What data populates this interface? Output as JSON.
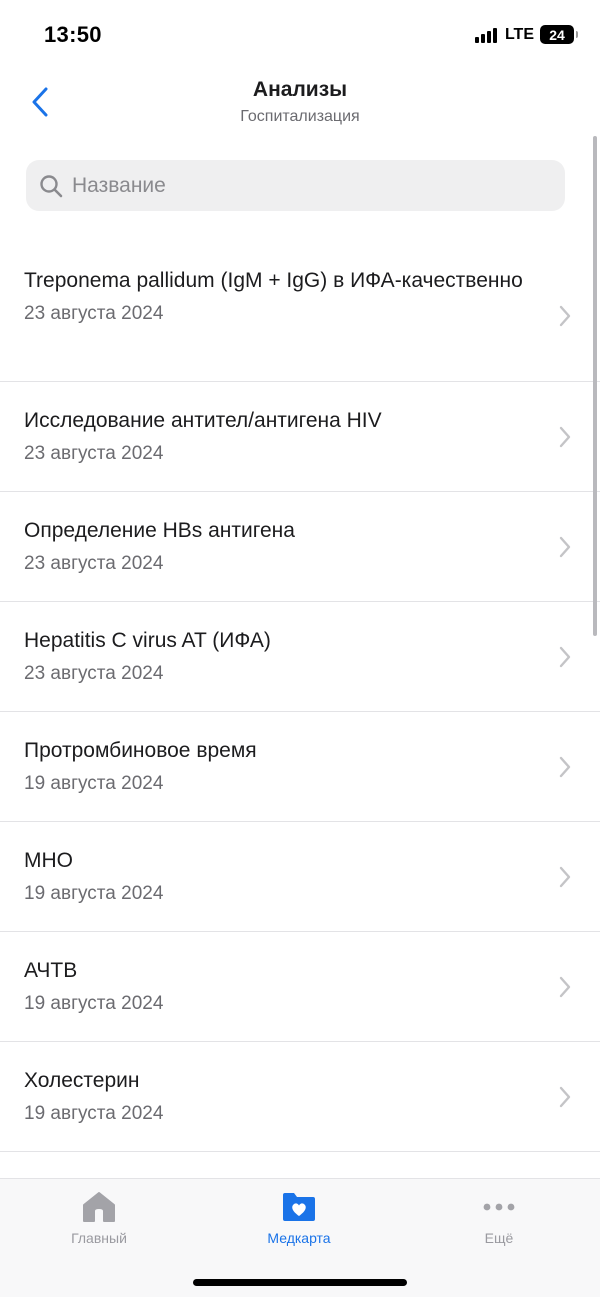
{
  "status_bar": {
    "time": "13:50",
    "network": "LTE",
    "battery": "24"
  },
  "header": {
    "title": "Анализы",
    "subtitle": "Госпитализация",
    "back_icon": "chevron-left-icon"
  },
  "search": {
    "placeholder": "Название",
    "value": ""
  },
  "list": {
    "items": [
      {
        "title": "Treponema pallidum (IgM + IgG) в ИФА-качественно",
        "date": "23 августа 2024"
      },
      {
        "title": "Исследование антител/антигена HIV",
        "date": "23 августа 2024"
      },
      {
        "title": "Определение HBs антигена",
        "date": "23 августа 2024"
      },
      {
        "title": "Hepatitis C virus AT (ИФА)",
        "date": "23 августа 2024"
      },
      {
        "title": "Протромбиновое время",
        "date": "19 августа 2024"
      },
      {
        "title": "МНО",
        "date": "19 августа 2024"
      },
      {
        "title": "АЧТВ",
        "date": "19 августа 2024"
      },
      {
        "title": "Холестерин",
        "date": "19 августа 2024"
      }
    ]
  },
  "tabbar": {
    "tabs": [
      {
        "label": "Главный",
        "icon": "home-icon",
        "active": false
      },
      {
        "label": "Медкарта",
        "icon": "medcard-folder-icon",
        "active": true
      },
      {
        "label": "Ещё",
        "icon": "more-dots-icon",
        "active": false
      }
    ]
  },
  "colors": {
    "accent": "#1a73e8",
    "inactive": "#9a9aa0",
    "secondary_text": "#6b6b70"
  }
}
